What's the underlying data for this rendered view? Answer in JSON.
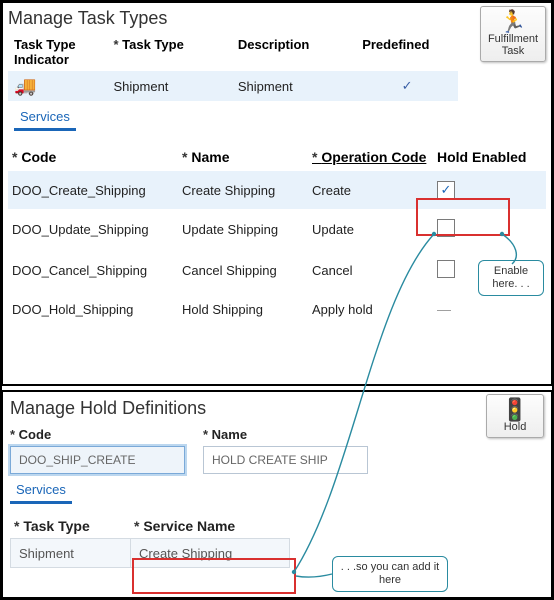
{
  "top": {
    "title": "Manage Task Types",
    "badge": {
      "label_line1": "Fulfillment",
      "label_line2": "Task"
    },
    "tt_headers": {
      "indicator": "Task Type Indicator",
      "tasktype": "Task Type",
      "description": "Description",
      "predefined": "Predefined"
    },
    "tt_row": {
      "tasktype": "Shipment",
      "description": "Shipment",
      "predefined_check": "✓"
    },
    "tab_label": "Services",
    "svc_headers": {
      "code": "Code",
      "name": "Name",
      "op": "Operation Code",
      "hold": "Hold Enabled"
    },
    "services": [
      {
        "code": "DOO_Create_Shipping",
        "name": "Create Shipping",
        "op": "Create",
        "hold": "checked"
      },
      {
        "code": "DOO_Update_Shipping",
        "name": "Update Shipping",
        "op": "Update",
        "hold": "empty"
      },
      {
        "code": "DOO_Cancel_Shipping",
        "name": "Cancel Shipping",
        "op": "Cancel",
        "hold": "empty"
      },
      {
        "code": "DOO_Hold_Shipping",
        "name": "Hold Shipping",
        "op": "Apply hold",
        "hold": "dash"
      }
    ],
    "tooltip1": "Enable here. . ."
  },
  "bottom": {
    "title": "Manage Hold Definitions",
    "badge": {
      "label": "Hold"
    },
    "labels": {
      "code": "Code",
      "name": "Name",
      "services_tab": "Services",
      "tasktype": "Task Type",
      "servicename": "Service Name"
    },
    "fields": {
      "code": "DOO_SHIP_CREATE",
      "name": "HOLD CREATE SHIP"
    },
    "row": {
      "tasktype": "Shipment",
      "servicename": "Create Shipping"
    },
    "tooltip2": ". . .so you can add it here"
  }
}
